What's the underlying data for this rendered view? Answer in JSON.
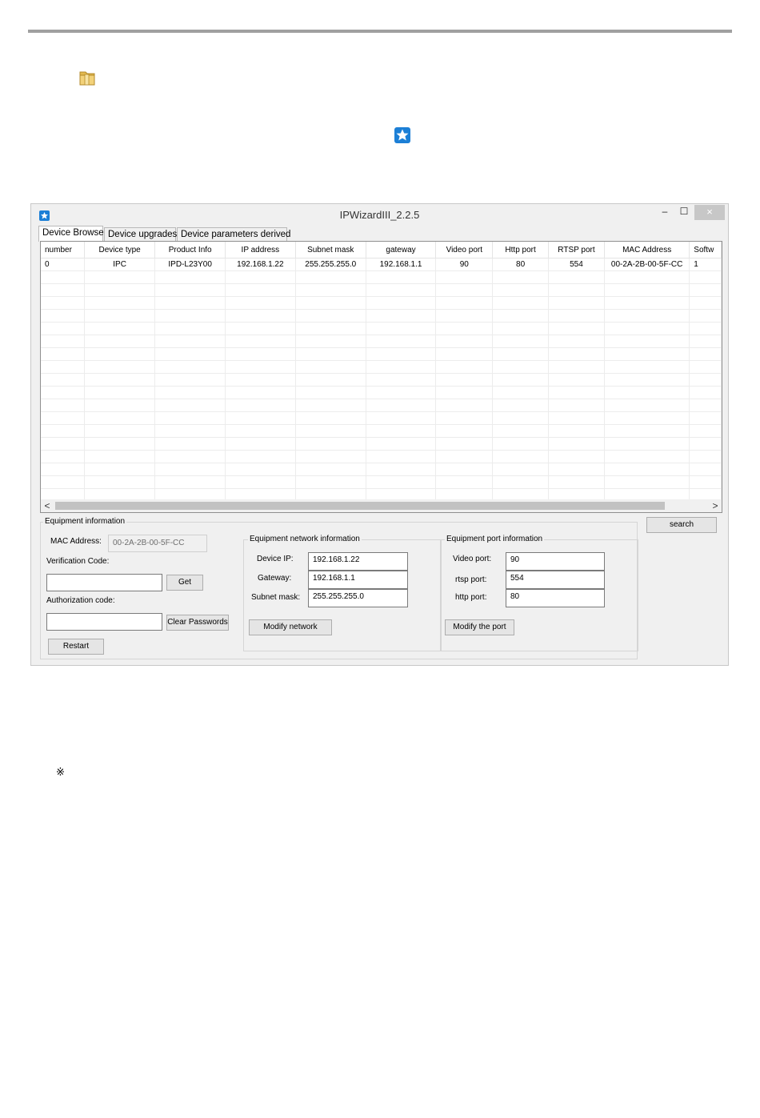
{
  "page": {
    "note_mark": "※"
  },
  "window": {
    "title": "IPWizardIII_2.2.5",
    "controls": {
      "minimize": "–",
      "maximize": "☐",
      "close": "×"
    }
  },
  "tabs": [
    {
      "label": "Device Browse",
      "active": true
    },
    {
      "label": "Device upgrades",
      "active": false
    },
    {
      "label": "Device parameters derived",
      "active": false
    }
  ],
  "grid": {
    "columns": [
      "number",
      "Device type",
      "Product Info",
      "IP address",
      "Subnet mask",
      "gateway",
      "Video port",
      "Http port",
      "RTSP port",
      "MAC Address",
      "Softw"
    ],
    "rows": [
      [
        "0",
        "IPC",
        "IPD-L23Y00",
        "192.168.1.22",
        "255.255.255.0",
        "192.168.1.1",
        "90",
        "80",
        "554",
        "00-2A-2B-00-5F-CC",
        "1"
      ]
    ],
    "empty_rows": 19,
    "scroll_left": "<",
    "scroll_right": ">"
  },
  "equipment_info": {
    "group_label": "Equipment information",
    "mac_label": "MAC Address:",
    "mac_value": "00-2A-2B-00-5F-CC",
    "verification_label": "Verification Code:",
    "verification_value": "",
    "get_button": "Get",
    "authorization_label": "Authorization code:",
    "authorization_value": "",
    "clear_button": "Clear Passwords",
    "restart_button": "Restart"
  },
  "network_info": {
    "group_label": "Equipment network information",
    "device_ip_label": "Device IP:",
    "device_ip_value": "192.168.1.22",
    "gateway_label": "Gateway:",
    "gateway_value": "192.168.1.1",
    "subnet_label": "Subnet mask:",
    "subnet_value": "255.255.255.0",
    "modify_button": "Modify network"
  },
  "port_info": {
    "group_label": "Equipment port information",
    "video_label": "Video port:",
    "video_value": "90",
    "rtsp_label": "rtsp port:",
    "rtsp_value": "554",
    "http_label": "http port:",
    "http_value": "80",
    "modify_button": "Modify the port"
  },
  "search_button": "search",
  "colors": {
    "accent_blue": "#1c7fd6",
    "folder_yellow": "#e9c45a"
  }
}
